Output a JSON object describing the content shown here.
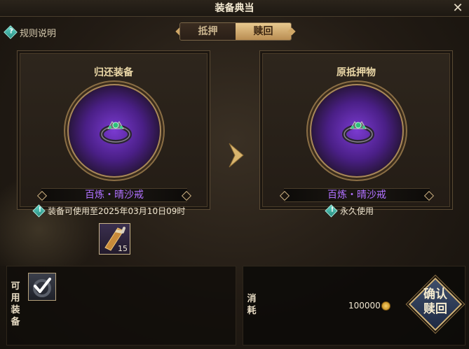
{
  "window": {
    "title": "装备典当",
    "close_label": "✕"
  },
  "rules": {
    "icon_text": "?",
    "label": "规则说明"
  },
  "tabs": [
    {
      "label": "抵押",
      "active": false
    },
    {
      "label": "赎回",
      "active": true
    }
  ],
  "left_panel": {
    "title": "归还装备",
    "item_name": "百炼・晴沙戒",
    "info_icon": "!",
    "info_text": "装备可使用至2025年03月10日09时"
  },
  "right_panel": {
    "title": "原抵押物",
    "item_name": "百炼・晴沙戒",
    "info_icon": "!",
    "info_text": "永久使用"
  },
  "scroll_item": {
    "icon": "scroll-icon",
    "quantity": "15"
  },
  "equip_list": {
    "label": "可用装备",
    "slot_icon": "equipped-check-icon"
  },
  "cost": {
    "label": "消耗",
    "value": "100000",
    "currency_icon": "coin-icon"
  },
  "confirm_button": {
    "label": "确认赎回"
  },
  "colors": {
    "item_name": "#b071ff",
    "accent_gold": "#cfa767",
    "info_teal": "#5fd6c6"
  }
}
